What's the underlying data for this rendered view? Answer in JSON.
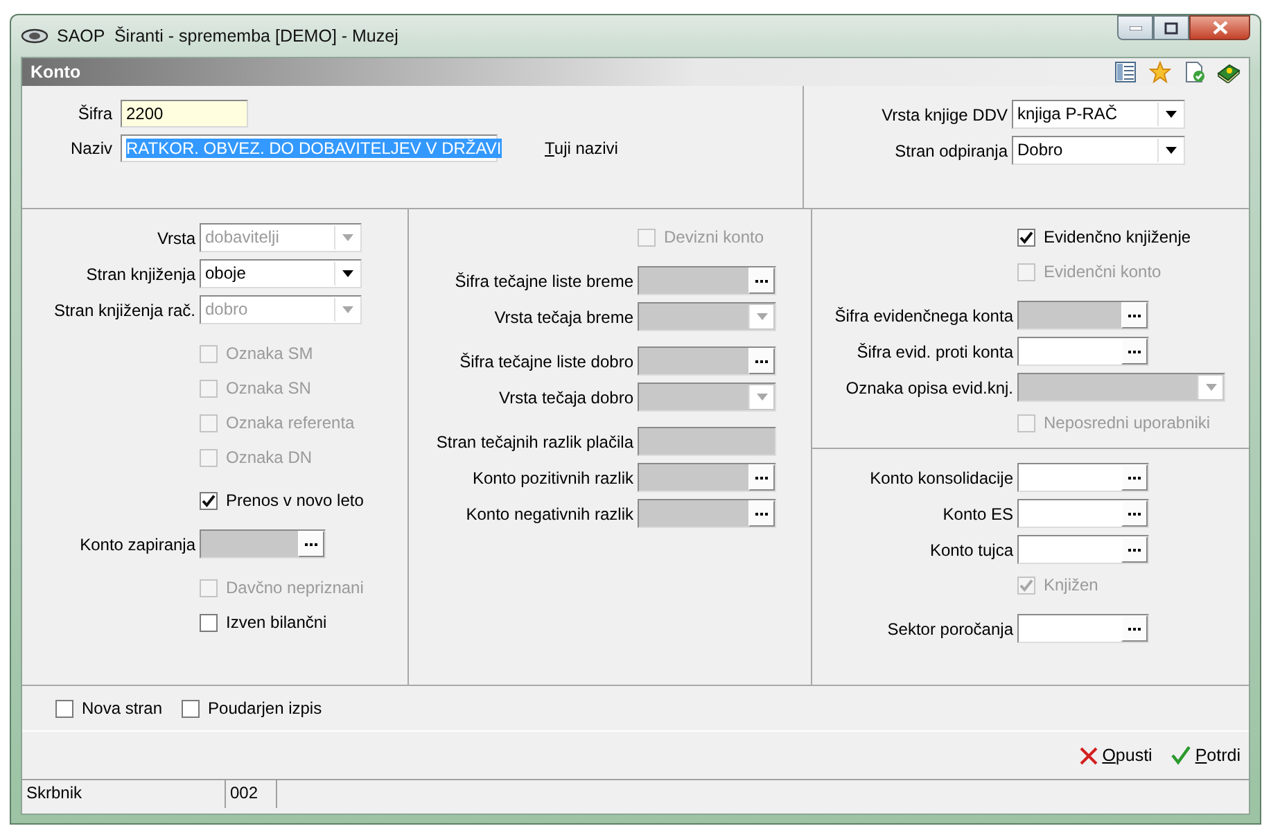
{
  "window": {
    "title": "SAOP  Širanti - sprememba [DEMO] - Muzej"
  },
  "form_title": "Konto",
  "header": {
    "sifra": {
      "label": "Šifra",
      "value": "2200",
      "highlighted": true
    },
    "naziv": {
      "label": "Naziv",
      "value": "RATKOR. OBVEZ. DO DOBAVITELJEV V DRŽAVI",
      "text_selected": true
    },
    "link": "Tuji nazivi",
    "right": [
      {
        "kind": "combo",
        "label": "Vrsta knjige DDV",
        "value": "knjiga P-RAČ",
        "disabled": false
      },
      {
        "kind": "combo",
        "label": "Stran odpiranja",
        "value": "Dobro",
        "disabled": false
      }
    ]
  },
  "columns": [
    {
      "sections": [
        [
          [
            {
              "kind": "combo",
              "label": "Vrsta",
              "value": "dobavitelji",
              "disabled": true
            },
            {
              "kind": "combo",
              "label": "Stran knjiženja",
              "value": "oboje",
              "disabled": false
            },
            {
              "kind": "combo",
              "label": "Stran knjiženja rač.",
              "value": "dobro",
              "disabled": true
            }
          ],
          [
            {
              "kind": "checkbox",
              "label": "Oznaka SM",
              "checked": false,
              "disabled": true
            },
            {
              "kind": "checkbox",
              "label": "Oznaka SN",
              "checked": false,
              "disabled": true
            },
            {
              "kind": "checkbox",
              "label": "Oznaka referenta",
              "checked": false,
              "disabled": true
            },
            {
              "kind": "checkbox",
              "label": "Oznaka DN",
              "checked": false,
              "disabled": true
            }
          ],
          [
            {
              "kind": "checkbox",
              "label": "Prenos v novo leto",
              "checked": true,
              "disabled": false
            }
          ],
          [
            {
              "kind": "lookup",
              "label": "Konto zapiranja",
              "disabled": true
            }
          ],
          [
            {
              "kind": "checkbox",
              "label": "Davčno nepriznani",
              "checked": false,
              "disabled": true
            },
            {
              "kind": "checkbox",
              "label": "Izven bilančni",
              "checked": false,
              "disabled": false
            }
          ]
        ]
      ]
    },
    {
      "sections": [
        [
          [
            {
              "kind": "checkbox",
              "label": "Devizni konto",
              "checked": false,
              "disabled": true
            }
          ],
          [
            {
              "kind": "lookup",
              "label": "Šifra tečajne liste breme",
              "disabled": true
            },
            {
              "kind": "combo",
              "label": "Vrsta tečaja breme",
              "disabled": true
            }
          ],
          [
            {
              "kind": "lookup",
              "label": "Šifra tečajne liste dobro",
              "disabled": true
            },
            {
              "kind": "combo",
              "label": "Vrsta tečaja dobro",
              "disabled": true
            }
          ],
          [
            {
              "kind": "text",
              "label": "Stran tečajnih razlik plačila",
              "disabled": true
            },
            {
              "kind": "lookup",
              "label": "Konto pozitivnih razlik",
              "disabled": true
            },
            {
              "kind": "lookup",
              "label": "Konto negativnih razlik",
              "disabled": true
            }
          ]
        ]
      ]
    },
    {
      "sections": [
        [
          [
            {
              "kind": "checkbox",
              "label": "Evidenčno knjiženje",
              "checked": true,
              "disabled": false
            },
            {
              "kind": "checkbox",
              "label": "Evidenčni konto",
              "checked": false,
              "disabled": true
            }
          ],
          [
            {
              "kind": "lookup",
              "label": "Šifra evidenčnega konta",
              "disabled": true
            },
            {
              "kind": "lookup",
              "label": "Šifra evid. proti konta",
              "disabled": false
            },
            {
              "kind": "combo",
              "label": "Oznaka opisa evid.knj.",
              "disabled": true
            },
            {
              "kind": "checkbox",
              "label": "Neposredni uporabniki",
              "checked": false,
              "disabled": true
            }
          ]
        ],
        [
          [
            {
              "kind": "lookup",
              "label": "Konto konsolidacije",
              "disabled": false
            },
            {
              "kind": "lookup",
              "label": "Konto ES",
              "disabled": false
            },
            {
              "kind": "lookup",
              "label": "Konto tujca",
              "disabled": false
            },
            {
              "kind": "checkbox",
              "label": "Knjižen",
              "checked": true,
              "disabled": true
            }
          ],
          [
            {
              "kind": "lookup",
              "label": "Sektor poročanja",
              "disabled": false
            }
          ]
        ]
      ]
    }
  ],
  "options": [
    {
      "label": "Nova stran",
      "checked": false
    },
    {
      "label": "Poudarjen izpis",
      "checked": false
    }
  ],
  "buttons": [
    {
      "kind": "cancel",
      "label": "Opusti"
    },
    {
      "kind": "confirm",
      "label": "Potrdi"
    }
  ],
  "status_bar": [
    "Skrbnik",
    "002"
  ]
}
